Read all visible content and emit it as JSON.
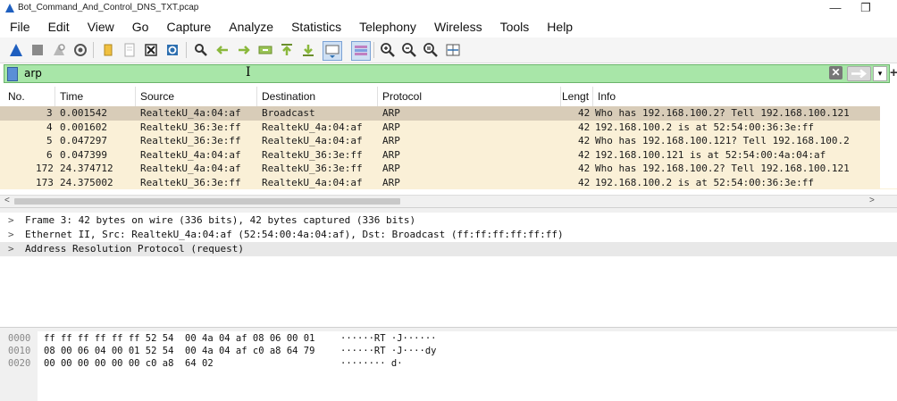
{
  "window": {
    "title": "Bot_Command_And_Control_DNS_TXT.pcap",
    "minimize_glyph": "—",
    "restore_glyph": "❐"
  },
  "menu": [
    "File",
    "Edit",
    "View",
    "Go",
    "Capture",
    "Analyze",
    "Statistics",
    "Telephony",
    "Wireless",
    "Tools",
    "Help"
  ],
  "toolbar": {
    "icons": [
      "shark-fin-start-icon",
      "stop-capture-icon",
      "restart-capture-icon",
      "capture-options-icon",
      "open-file-icon",
      "save-file-icon",
      "close-file-icon",
      "reload-file-icon",
      "find-packet-icon",
      "go-back-icon",
      "go-forward-icon",
      "go-to-packet-icon",
      "go-first-packet-icon",
      "go-last-packet-icon",
      "auto-scroll-icon",
      "colorize-icon",
      "zoom-in-icon",
      "zoom-out-icon",
      "zoom-normal-icon",
      "resize-columns-icon"
    ]
  },
  "filter": {
    "value": "arp",
    "clear_glyph": "✕",
    "apply_glyph": "⇒",
    "dropdown_glyph": "▾",
    "add_glyph": "+"
  },
  "packet_list": {
    "columns": [
      "No.",
      "Time",
      "Source",
      "Destination",
      "Protocol",
      "Lengt",
      "Info"
    ],
    "rows": [
      {
        "no": "3",
        "time": "0.001542",
        "source": "RealtekU_4a:04:af",
        "destination": "Broadcast",
        "protocol": "ARP",
        "length": "42",
        "info": "Who has 192.168.100.2? Tell 192.168.100.121",
        "selected": true
      },
      {
        "no": "4",
        "time": "0.001602",
        "source": "RealtekU_36:3e:ff",
        "destination": "RealtekU_4a:04:af",
        "protocol": "ARP",
        "length": "42",
        "info": "192.168.100.2 is at 52:54:00:36:3e:ff",
        "selected": false
      },
      {
        "no": "5",
        "time": "0.047297",
        "source": "RealtekU_36:3e:ff",
        "destination": "RealtekU_4a:04:af",
        "protocol": "ARP",
        "length": "42",
        "info": "Who has 192.168.100.121? Tell 192.168.100.2",
        "selected": false
      },
      {
        "no": "6",
        "time": "0.047399",
        "source": "RealtekU_4a:04:af",
        "destination": "RealtekU_36:3e:ff",
        "protocol": "ARP",
        "length": "42",
        "info": "192.168.100.121 is at 52:54:00:4a:04:af",
        "selected": false
      },
      {
        "no": "172",
        "time": "24.374712",
        "source": "RealtekU_4a:04:af",
        "destination": "RealtekU_36:3e:ff",
        "protocol": "ARP",
        "length": "42",
        "info": "Who has 192.168.100.2? Tell 192.168.100.121",
        "selected": false
      },
      {
        "no": "173",
        "time": "24.375002",
        "source": "RealtekU_36:3e:ff",
        "destination": "RealtekU_4a:04:af",
        "protocol": "ARP",
        "length": "42",
        "info": "192.168.100.2 is at 52:54:00:36:3e:ff",
        "selected": false
      }
    ],
    "scroll_left_glyph": "<",
    "scroll_right_glyph": ">"
  },
  "details": [
    {
      "chevron": ">",
      "text": "Frame 3: 42 bytes on wire (336 bits), 42 bytes captured (336 bits)",
      "selected": false
    },
    {
      "chevron": ">",
      "text": "Ethernet II, Src: RealtekU_4a:04:af (52:54:00:4a:04:af), Dst: Broadcast (ff:ff:ff:ff:ff:ff)",
      "selected": false
    },
    {
      "chevron": ">",
      "text": "Address Resolution Protocol (request)",
      "selected": true
    }
  ],
  "bytes": [
    {
      "offset": "0000",
      "hex": "ff ff ff ff ff ff 52 54  00 4a 04 af 08 06 00 01",
      "ascii": "······RT ·J······"
    },
    {
      "offset": "0010",
      "hex": "08 00 06 04 00 01 52 54  00 4a 04 af c0 a8 64 79",
      "ascii": "······RT ·J····dy"
    },
    {
      "offset": "0020",
      "hex": "00 00 00 00 00 00 c0 a8  64 02",
      "ascii": "········ d·"
    }
  ],
  "colors": {
    "filter_valid_bg": "#a8e6a8",
    "arp_row_bg": "#faf0d7",
    "selected_row_bg": "#d8ccb8"
  }
}
